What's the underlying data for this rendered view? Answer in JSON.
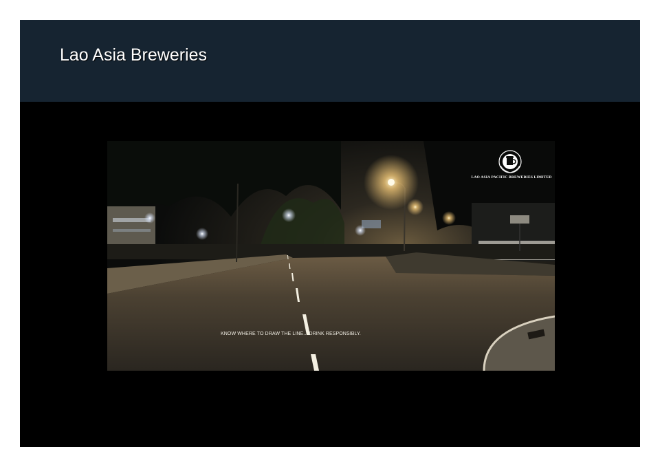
{
  "slide": {
    "title": "Lao Asia Breweries"
  },
  "ad": {
    "slogan": "KNOW WHERE TO DRAW THE LINE... DRINK RESPONSIBLY.",
    "logo_caption": "LAO ASIA PACIFIC BREWERIES LIMITED",
    "logo_ring_text": "LAO ASIA PACIFIC",
    "logo_icon": "beer-mug-emblem-icon"
  },
  "colors": {
    "header_background": "#162431",
    "slide_background": "#000000",
    "road_line": "#f4f0e2"
  }
}
